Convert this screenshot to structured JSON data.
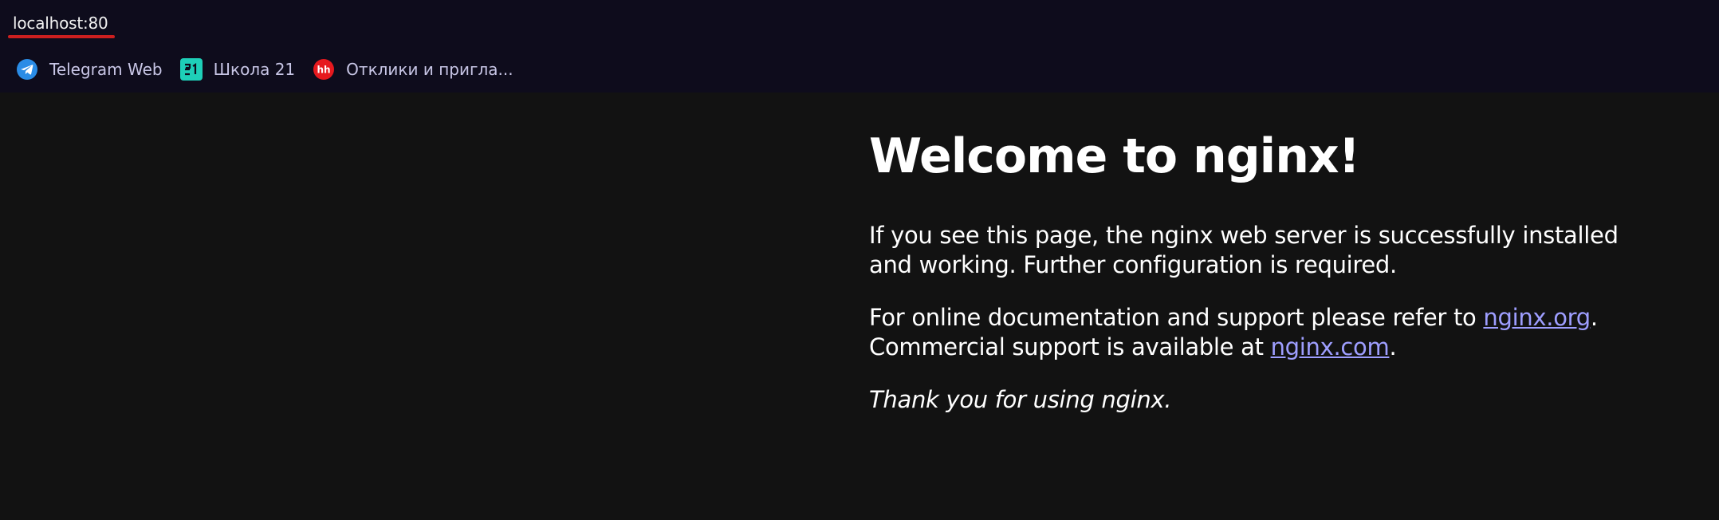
{
  "browser": {
    "url": "localhost:80",
    "accent_underline_color": "#cc1f1f",
    "bookmarks": [
      {
        "label": "Telegram Web",
        "icon": "telegram-icon",
        "color": "#2a8ce6"
      },
      {
        "label": "Школа 21",
        "icon": "school21-icon",
        "color": "#1ecfb8"
      },
      {
        "label": "Отклики и пригла...",
        "icon": "hh-icon",
        "color": "#e6191e",
        "icon_text": "hh"
      }
    ]
  },
  "page": {
    "heading": "Welcome to nginx!",
    "para1": "If you see this page, the nginx web server is successfully installed and working. Further configuration is required.",
    "para2_before_link": "For online documentation and support please refer to ",
    "link_org": "nginx.org",
    "para2_after_link": ".",
    "para2_line2_before": "Commercial support is available at ",
    "link_com": "nginx.com",
    "para2_line2_after": ".",
    "para3": "Thank you for using nginx."
  }
}
